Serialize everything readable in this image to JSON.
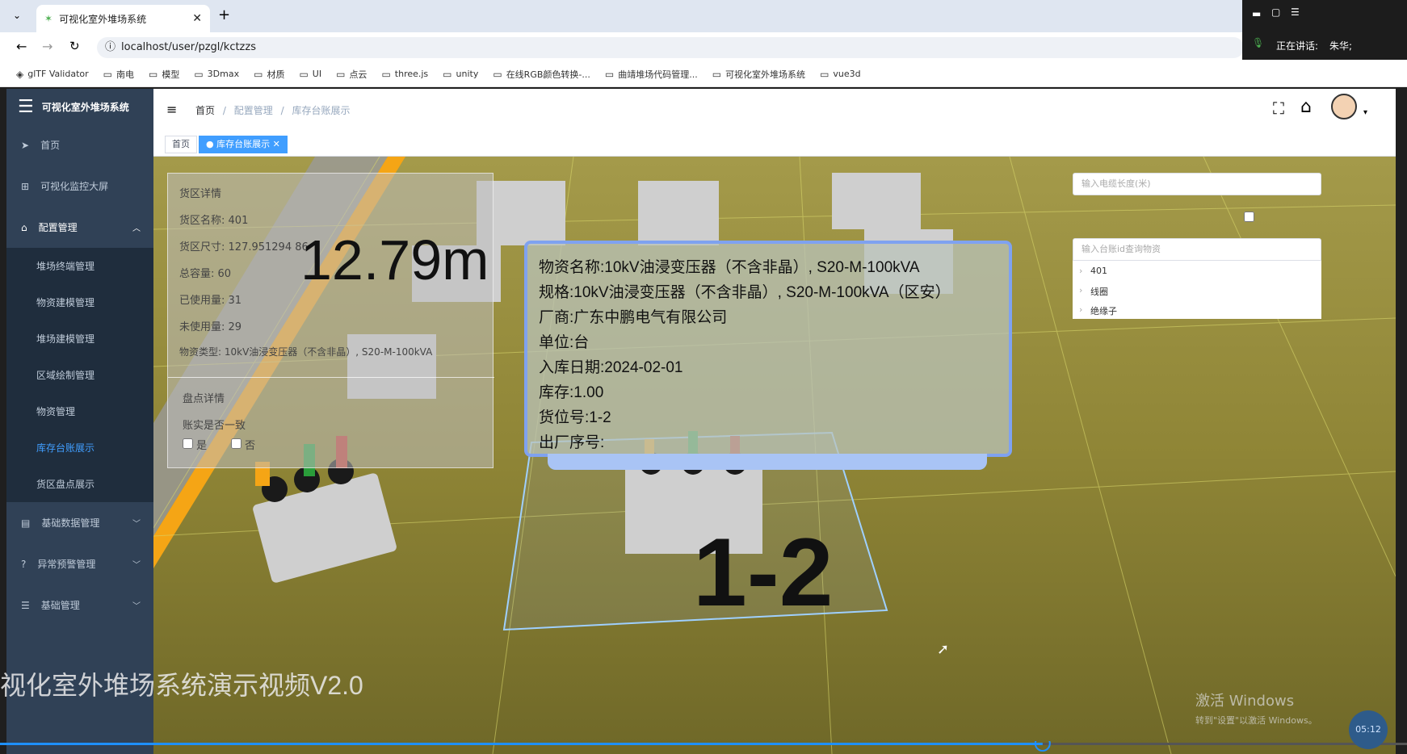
{
  "browser": {
    "tab_title": "可视化室外堆场系统",
    "url": "localhost/user/pzgl/kctzzs",
    "bookmarks": [
      "glTF Validator",
      "南电",
      "模型",
      "3Dmax",
      "材质",
      "UI",
      "点云",
      "three.js",
      "unity",
      "在线RGB颜色转换-...",
      "曲靖堆场代码管理...",
      "可视化室外堆场系统",
      "vue3d"
    ]
  },
  "meeting": {
    "speaking_label": "正在讲话:",
    "speaker": "朱华;"
  },
  "app": {
    "title": "可视化室外堆场系统"
  },
  "sidebar": {
    "items": [
      {
        "label": "首页",
        "icon": "send-icon"
      },
      {
        "label": "可视化监控大屏",
        "icon": "tree-icon"
      },
      {
        "label": "配置管理",
        "icon": "cog-icon",
        "expanded": true
      }
    ],
    "sub_items": [
      "堆场终端管理",
      "物资建模管理",
      "堆场建模管理",
      "区域绘制管理",
      "物资管理",
      "库存台账展示",
      "货区盘点展示"
    ],
    "active_sub": "库存台账展示",
    "bottom_items": [
      {
        "label": "基础数据管理",
        "icon": "database-icon"
      },
      {
        "label": "异常预警管理",
        "icon": "question-icon"
      },
      {
        "label": "基础管理",
        "icon": "list-icon"
      }
    ]
  },
  "breadcrumb": [
    "首页",
    "配置管理",
    "库存台账展示"
  ],
  "tags": [
    "首页",
    "库存台账展示"
  ],
  "cargo_panel": {
    "title": "货区详情",
    "name_label": "货区名称:",
    "name_value": "401",
    "size_label": "货区尺寸:",
    "size_value": "127.951294 86",
    "capacity_label": "总容量:",
    "capacity_value": "60",
    "used_label": "已使用量:",
    "used_value": "31",
    "unused_label": "未使用量:",
    "unused_value": "29",
    "type_label": "物资类型:",
    "type_value": "10kV油浸变压器（不含非晶）, S20-M-100kVA",
    "check_title": "盘点详情",
    "check_question": "账实是否一致",
    "yes": "是",
    "no": "否"
  },
  "measure_text": "12.79m",
  "slot_label": "1-2",
  "popup": {
    "name": "物资名称:10kV油浸变压器（不含非晶）, S20-M-100kVA",
    "spec": "规格:10kV油浸变压器（不含非晶）, S20-M-100kVA（区安）",
    "maker": "厂商:广东中鹏电气有限公司",
    "unit": "单位:台",
    "date": "入库日期:2024-02-01",
    "stock": "库存:1.00",
    "slot": "货位号:1-2",
    "serial": "出厂序号:"
  },
  "right_panel": {
    "length_placeholder": "输入电缆长度(米)",
    "query_placeholder": "输入台账id查询物资",
    "tree": [
      "401",
      "线圈",
      "绝缘子"
    ]
  },
  "caption": "视化室外堆场系统演示视频V2.0",
  "windows_watermark": {
    "line1": "激活 Windows",
    "line2": "转到\"设置\"以激活 Windows。"
  },
  "video": {
    "time": "05:12",
    "progress": 0.741
  },
  "colors": {
    "sidebar": "#304156",
    "accent": "#409eff",
    "ground": "#9c9240"
  }
}
